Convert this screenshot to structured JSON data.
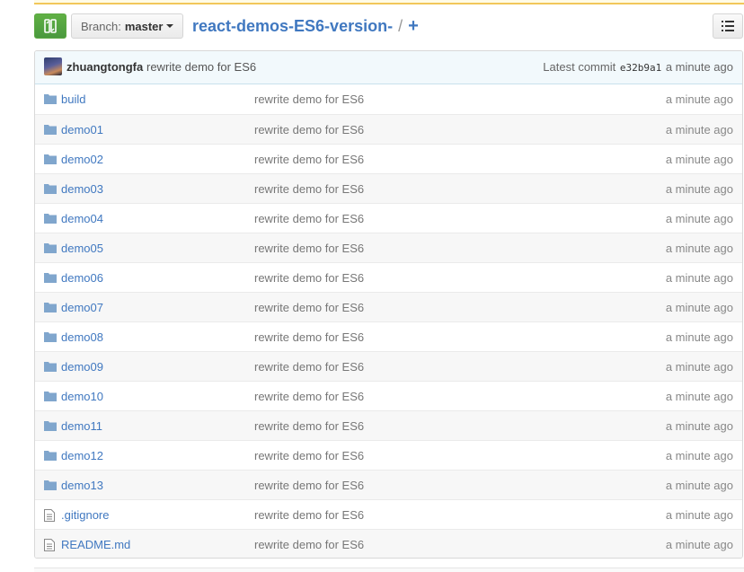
{
  "nav": {
    "branch_label": "Branch:",
    "branch_name": "master",
    "repo_name": "react-demos-ES6-version-",
    "separator": "/",
    "add_label": "+"
  },
  "commit": {
    "author": "zhuangtongfa",
    "message": "rewrite demo for ES6",
    "latest_label": "Latest commit",
    "sha": "e32b9a1",
    "time": "a minute ago"
  },
  "files": [
    {
      "name": "build",
      "type": "dir",
      "message": "rewrite demo for ES6",
      "age": "a minute ago"
    },
    {
      "name": "demo01",
      "type": "dir",
      "message": "rewrite demo for ES6",
      "age": "a minute ago"
    },
    {
      "name": "demo02",
      "type": "dir",
      "message": "rewrite demo for ES6",
      "age": "a minute ago"
    },
    {
      "name": "demo03",
      "type": "dir",
      "message": "rewrite demo for ES6",
      "age": "a minute ago"
    },
    {
      "name": "demo04",
      "type": "dir",
      "message": "rewrite demo for ES6",
      "age": "a minute ago"
    },
    {
      "name": "demo05",
      "type": "dir",
      "message": "rewrite demo for ES6",
      "age": "a minute ago"
    },
    {
      "name": "demo06",
      "type": "dir",
      "message": "rewrite demo for ES6",
      "age": "a minute ago"
    },
    {
      "name": "demo07",
      "type": "dir",
      "message": "rewrite demo for ES6",
      "age": "a minute ago"
    },
    {
      "name": "demo08",
      "type": "dir",
      "message": "rewrite demo for ES6",
      "age": "a minute ago"
    },
    {
      "name": "demo09",
      "type": "dir",
      "message": "rewrite demo for ES6",
      "age": "a minute ago"
    },
    {
      "name": "demo10",
      "type": "dir",
      "message": "rewrite demo for ES6",
      "age": "a minute ago"
    },
    {
      "name": "demo11",
      "type": "dir",
      "message": "rewrite demo for ES6",
      "age": "a minute ago"
    },
    {
      "name": "demo12",
      "type": "dir",
      "message": "rewrite demo for ES6",
      "age": "a minute ago"
    },
    {
      "name": "demo13",
      "type": "dir",
      "message": "rewrite demo for ES6",
      "age": "a minute ago"
    },
    {
      "name": ".gitignore",
      "type": "file",
      "message": "rewrite demo for ES6",
      "age": "a minute ago"
    },
    {
      "name": "README.md",
      "type": "file",
      "message": "rewrite demo for ES6",
      "age": "a minute ago"
    }
  ],
  "colors": {
    "link": "#4078c0",
    "compare_green": "#60b044",
    "folder": "#80a6cd",
    "commit_bar": "#f2f9fc"
  },
  "icons": {
    "compare": "compare-icon",
    "caret": "caret-down-icon",
    "list": "list-icon",
    "folder": "folder-icon",
    "file": "file-text-icon"
  }
}
